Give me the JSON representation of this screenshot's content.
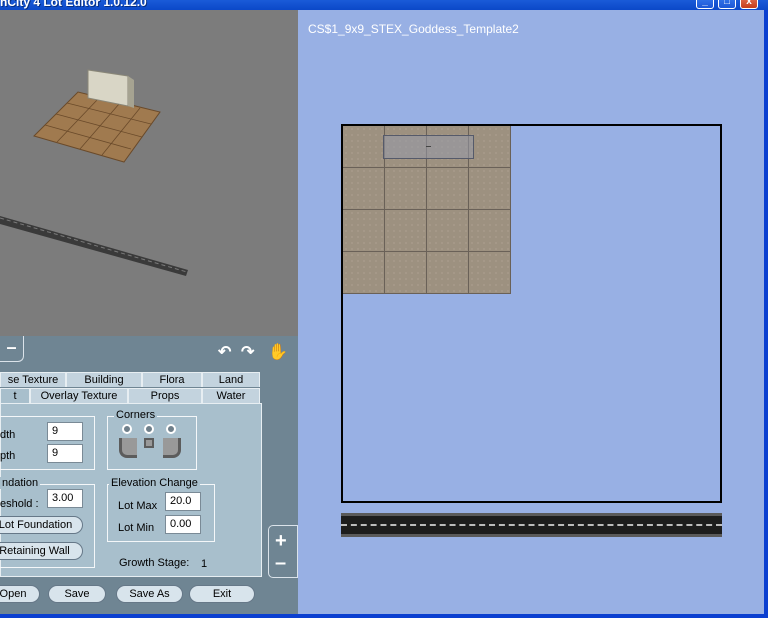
{
  "window": {
    "title": "nCity 4 Lot Editor 1.0.12.0",
    "controls": [
      "_",
      "□",
      "x"
    ]
  },
  "lot": {
    "name": "CS$1_9x9_STEX_Goddess_Template2"
  },
  "toolbar": {
    "collapse_symbol": "–",
    "rotate_left_symbol": "↶",
    "rotate_right_symbol": "↷",
    "pan_symbol": "✋"
  },
  "tabs": {
    "row1": [
      "se Texture",
      "Building",
      "Flora",
      "Land"
    ],
    "row2": [
      "t",
      "Overlay Texture",
      "Props",
      "Water"
    ]
  },
  "size": {
    "width_label": "dth",
    "width_value": "9",
    "depth_label": "pth",
    "depth_value": "9"
  },
  "corners": {
    "title": "Corners"
  },
  "foundation": {
    "title": "ndation",
    "threshold_label": "eshold :",
    "threshold_value": "3.00",
    "lot_foundation_button": "Lot Foundation",
    "retaining_wall_button": "Retaining Wall"
  },
  "elevation": {
    "title": "Elevation Change",
    "lot_max_label": "Lot Max",
    "lot_max_value": "20.0",
    "lot_min_label": "Lot Min",
    "lot_min_value": "0.00"
  },
  "growth": {
    "label": "Growth Stage:",
    "value": "1"
  },
  "buttons": {
    "open": "Open",
    "save": "Save",
    "save_as": "Save As",
    "exit": "Exit"
  },
  "zoom": {
    "in_symbol": "+",
    "out_symbol": "–"
  },
  "colors": {
    "lot_view_background": "#98b0e4",
    "panel": "#6f8593",
    "tab": "#c3d3de",
    "titlebar": "#0b48c8"
  }
}
